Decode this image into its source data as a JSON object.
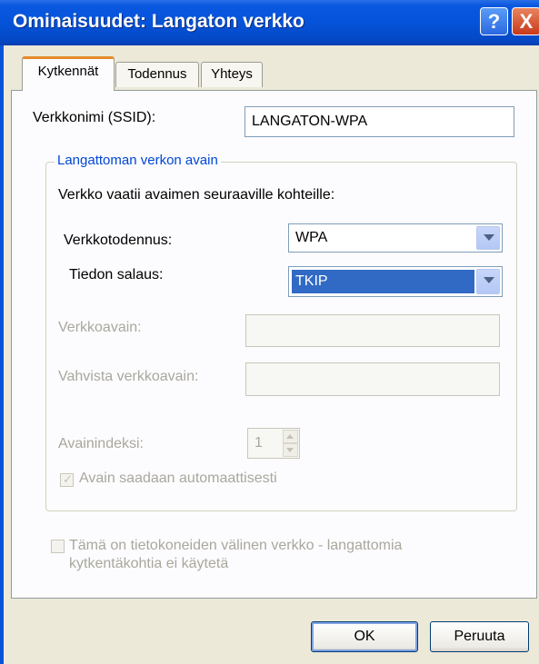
{
  "window": {
    "title": "Ominaisuudet: Langaton verkko"
  },
  "titlebar": {
    "help_glyph": "?",
    "close_glyph": "X"
  },
  "tabs": [
    {
      "label": "Kytkennät",
      "active": true
    },
    {
      "label": "Todennus",
      "active": false
    },
    {
      "label": "Yhteys",
      "active": false
    }
  ],
  "ssid": {
    "label": "Verkkonimi (SSID):",
    "value": "LANGATON-WPA"
  },
  "key_group": {
    "legend": "Langattoman verkon avain",
    "intro": "Verkko vaatii avaimen seuraaville kohteille:",
    "auth": {
      "label": "Verkkotodennus:",
      "value": "WPA"
    },
    "encryption": {
      "label": "Tiedon salaus:",
      "value": "TKIP"
    },
    "network_key": {
      "label": "Verkkoavain:",
      "value": ""
    },
    "confirm_key": {
      "label": "Vahvista verkkoavain:",
      "value": ""
    },
    "key_index": {
      "label": "Avainindeksi:",
      "value": "1"
    },
    "auto_key": {
      "label": "Avain saadaan automaattisesti",
      "checked": true
    }
  },
  "adhoc": {
    "line1": "Tämä on tietokoneiden välinen verkko - langattomia",
    "line2": "kytkentäkohtia ei käytetä",
    "checked": false
  },
  "buttons": {
    "ok": "OK",
    "cancel": "Peruuta"
  },
  "colors": {
    "titlebar": "#0553d9",
    "face": "#ECE9D8",
    "selection": "#316AC5",
    "group_legend": "#0046D5"
  }
}
